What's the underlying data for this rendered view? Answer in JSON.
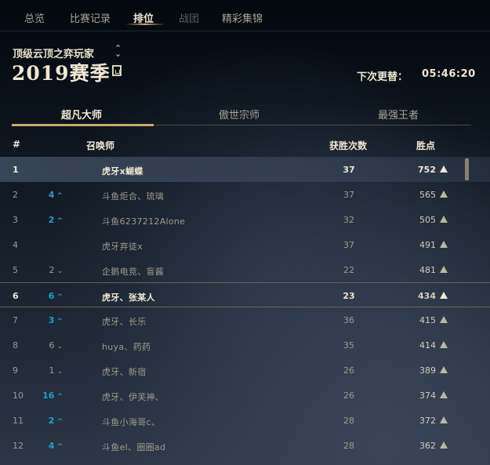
{
  "nav": {
    "tabs": [
      {
        "label": "总览"
      },
      {
        "label": "比赛记录"
      },
      {
        "label": "排位"
      },
      {
        "label": "战团"
      },
      {
        "label": "精彩集锦"
      }
    ]
  },
  "header": {
    "mode": "顶级云顶之弈玩家",
    "season": "2019赛季",
    "update_label": "下次更替：",
    "update_time": "05:46:20"
  },
  "tiers": [
    {
      "label": "超凡大师"
    },
    {
      "label": "傲世宗师"
    },
    {
      "label": "最强王者"
    }
  ],
  "columns": {
    "rank": "#",
    "summoner": "召唤师",
    "wins": "获胜次数",
    "points": "胜点"
  },
  "rows": [
    {
      "rank": "1",
      "change": "",
      "dir": "",
      "name": "虎牙x蝴蝶",
      "wins": "37",
      "points": "752"
    },
    {
      "rank": "2",
      "change": "4",
      "dir": "up",
      "name": "斗鱼炬合、琉璃",
      "wins": "37",
      "points": "565"
    },
    {
      "rank": "3",
      "change": "2",
      "dir": "up",
      "name": "斗鱼6237212Alone",
      "wins": "32",
      "points": "505"
    },
    {
      "rank": "4",
      "change": "",
      "dir": "",
      "name": "虎牙弃徒x",
      "wins": "37",
      "points": "491"
    },
    {
      "rank": "5",
      "change": "2",
      "dir": "down",
      "name": "企鹅电竞、盲酱",
      "wins": "22",
      "points": "481"
    },
    {
      "rank": "6",
      "change": "6",
      "dir": "up",
      "name": "虎牙、张某人",
      "wins": "23",
      "points": "434"
    },
    {
      "rank": "7",
      "change": "3",
      "dir": "up",
      "name": "虎牙、长乐",
      "wins": "36",
      "points": "415"
    },
    {
      "rank": "8",
      "change": "6",
      "dir": "down",
      "name": "huya、药药",
      "wins": "35",
      "points": "414"
    },
    {
      "rank": "9",
      "change": "1",
      "dir": "down",
      "name": "虎牙、新宿",
      "wins": "26",
      "points": "389"
    },
    {
      "rank": "10",
      "change": "16",
      "dir": "up",
      "name": "虎牙、伊芙神、",
      "wins": "26",
      "points": "374"
    },
    {
      "rank": "11",
      "change": "2",
      "dir": "up",
      "name": "斗鱼小海哥c、",
      "wins": "28",
      "points": "372"
    },
    {
      "rank": "12",
      "change": "4",
      "dir": "up",
      "name": "斗鱼el、圈圈ad",
      "wins": "28",
      "points": "362"
    }
  ],
  "colors": {
    "accent_gold": "#c8aa6e",
    "rank_up": "#1ea2c9",
    "text_primary": "#f0e6d2"
  }
}
